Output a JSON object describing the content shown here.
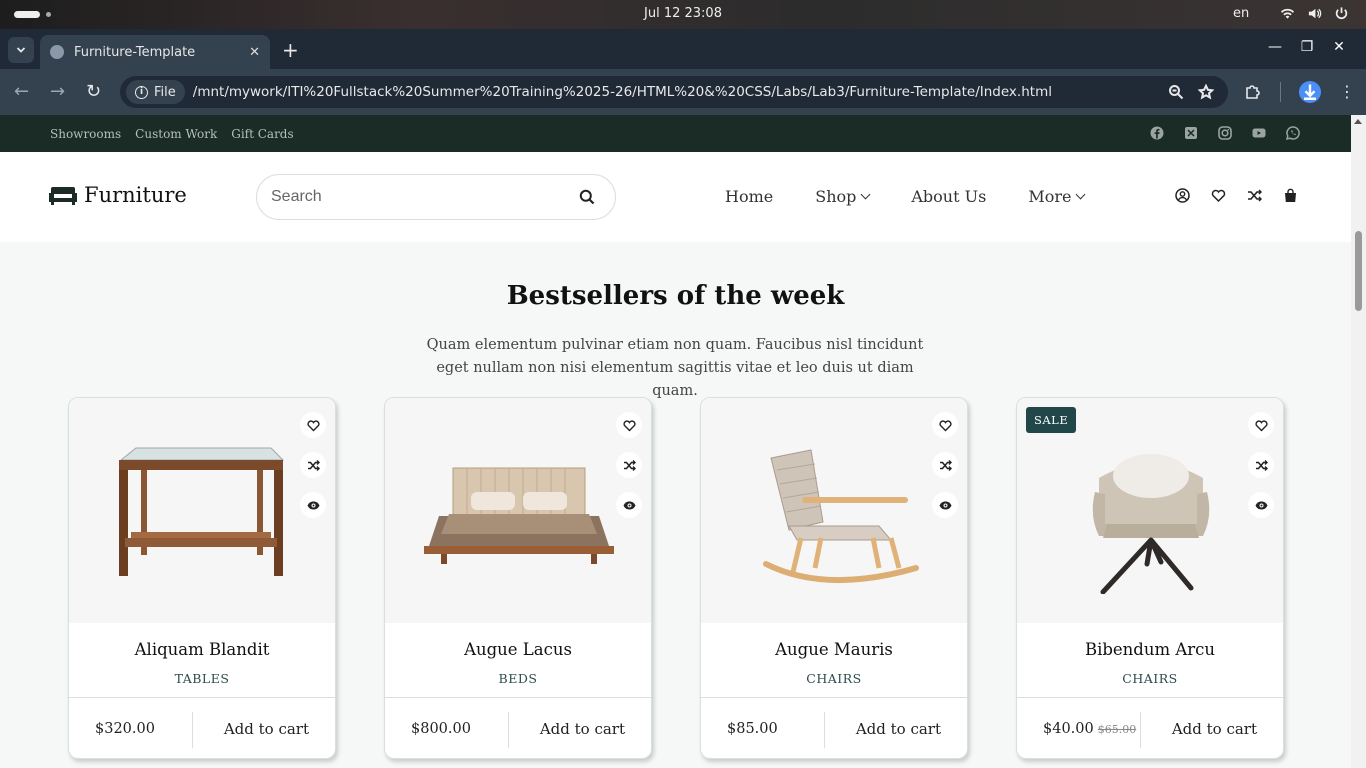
{
  "os": {
    "clock": "Jul 12  23:08",
    "language": "en"
  },
  "browser": {
    "tab_title": "Furniture-Template",
    "tab_close": "✕",
    "new_tab": "+",
    "file_chip": "File",
    "url": "/mnt/mywork/ITI%20Fullstack%20Summer%20Training%2025-26/HTML%20&%20CSS/Labs/Lab3/Furniture-Template/Index.html"
  },
  "topbar": {
    "links": [
      "Showrooms",
      "Custom Work",
      "Gift Cards"
    ]
  },
  "header": {
    "logo": "Furniture",
    "search_placeholder": "Search",
    "nav": [
      "Home",
      "Shop",
      "About Us",
      "More"
    ]
  },
  "section": {
    "title": "Bestsellers of the week",
    "description": "Quam elementum pulvinar etiam non quam. Faucibus nisl tincidunt eget nullam non nisi elementum sagittis vitae et leo duis ut diam quam."
  },
  "products": [
    {
      "name": "Aliquam Blandit",
      "category": "TABLES",
      "price": "$320.00",
      "cart": "Add to cart"
    },
    {
      "name": "Augue Lacus",
      "category": "BEDS",
      "price": "$800.00",
      "cart": "Add to cart"
    },
    {
      "name": "Augue Mauris",
      "category": "CHAIRS",
      "price": "$85.00",
      "cart": "Add to cart"
    },
    {
      "name": "Bibendum Arcu",
      "category": "CHAIRS",
      "price": "$40.00",
      "old_price": "$65.00",
      "badge": "SALE",
      "cart": "Add to cart"
    }
  ],
  "colors": {
    "topstrip": "#1b2b26",
    "badge": "#22474a",
    "page_bg": "#f6f8f8"
  }
}
